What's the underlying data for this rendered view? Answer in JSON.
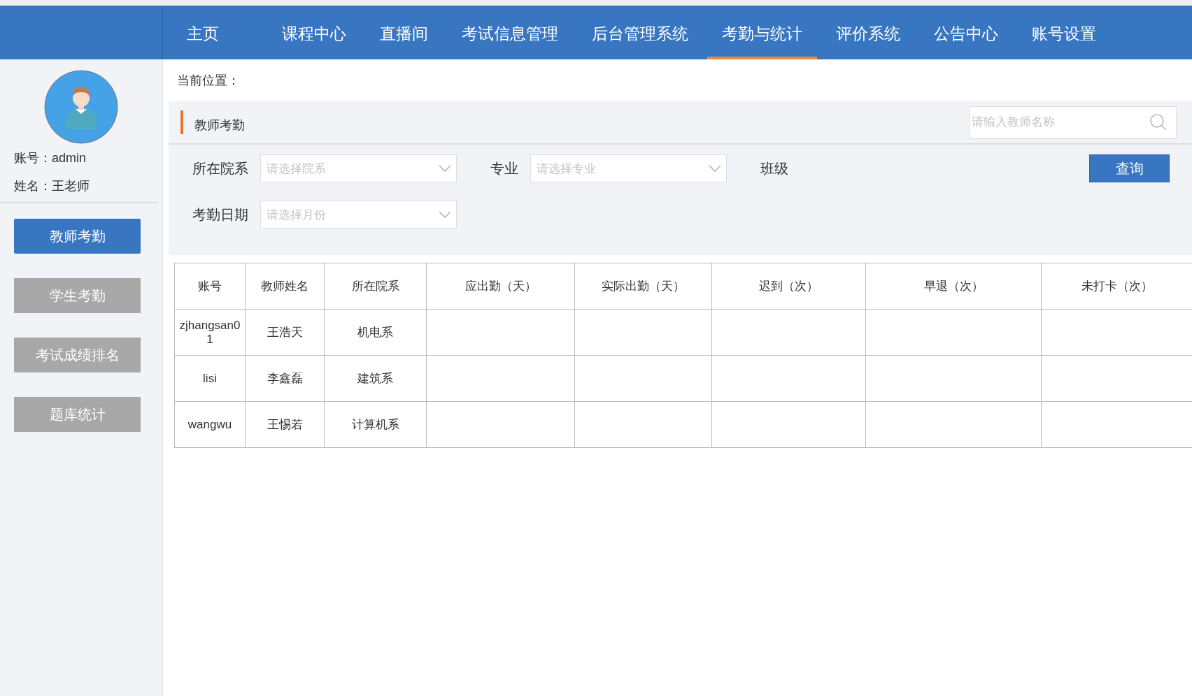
{
  "nav": [
    {
      "label": "主页",
      "selected": false
    },
    {
      "label": "课程中心",
      "selected": false
    },
    {
      "label": "直播间",
      "selected": false
    },
    {
      "label": "考试信息管理",
      "selected": false
    },
    {
      "label": "后台管理系统",
      "selected": false
    },
    {
      "label": "考勤与统计",
      "selected": true
    },
    {
      "label": "评价系统",
      "selected": false
    },
    {
      "label": "公告中心",
      "selected": false
    },
    {
      "label": "账号设置",
      "selected": false
    }
  ],
  "user": {
    "account": "账号：admin",
    "name": "姓名：王老师"
  },
  "sidebar": {
    "items": [
      {
        "label": "教师考勤",
        "selected": true
      },
      {
        "label": "学生考勤",
        "selected": false
      },
      {
        "label": "考试成绩排名",
        "selected": false
      },
      {
        "label": "题库统计",
        "selected": false
      }
    ]
  },
  "breadcrumb": "当前位置：",
  "panel": {
    "title": "教师考勤",
    "search": {
      "placeholder": "请输入教师名称"
    },
    "filters": [
      [
        {
          "kind": "select",
          "label": "所在院系",
          "placeholder": "请选择院系"
        },
        {
          "kind": "select",
          "label": "专业",
          "placeholder": "请选择专业"
        },
        {
          "kind": "label",
          "label": "班级"
        }
      ],
      [
        {
          "kind": "select",
          "label": "考勤日期",
          "placeholder": "请选择月份"
        }
      ]
    ],
    "button": "查询"
  },
  "table": {
    "columns": [
      "账号",
      "教师姓名",
      "所在院系",
      "应出勤（天）",
      "实际出勤（天）",
      "迟到（次）",
      "早退（次）",
      "未打卡（次）"
    ],
    "rows": [
      [
        "zjhangsan01",
        "王浩天",
        "机电系",
        "",
        "",
        "",
        "",
        ""
      ],
      [
        "lisi",
        "李鑫磊",
        "建筑系",
        "",
        "",
        "",
        "",
        ""
      ],
      [
        "wangwu",
        "王惕若",
        "计算机系",
        "",
        "",
        "",
        "",
        ""
      ]
    ]
  }
}
